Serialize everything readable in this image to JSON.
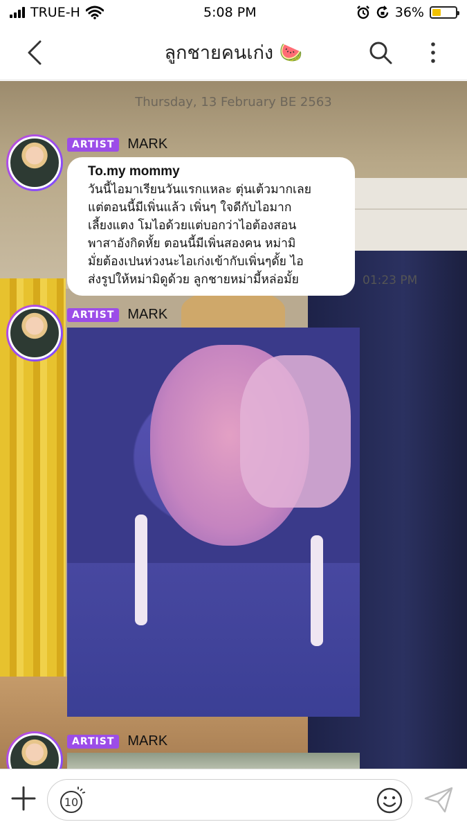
{
  "status_bar": {
    "carrier": "TRUE-H",
    "time": "5:08 PM",
    "battery": "36%",
    "battery_level": 0.36
  },
  "header": {
    "title": "ลูกชายคนเก่ง",
    "title_emoji": "🍉",
    "back_icon": "chevron-left-icon",
    "search_icon": "search-icon",
    "more_icon": "more-vertical-icon"
  },
  "chat": {
    "date_separator": "Thursday, 13 February BE 2563",
    "messages": [
      {
        "badge": "ARTIST",
        "sender": "MARK",
        "type": "text",
        "title": "To.my mommy",
        "text": "วันนี้ไอมาเรียนวันแรกแหละ ตุ่นเต้วมากเลย\nแต่ตอนนี้มีเพิ่นแล้ว เพิ่นๆ ใจดีกับไอมาก\nเลี้ยงแตง โมไอด้วยแต่บอกว่าไอต้องสอน\nพาสาอังกิดหั้ย ตอนนี้มีเพิ่นสองคน หม่ามิ\nมั่ยต้องเปนห่วงนะไอเก่งเข้ากับเพิ่นๆดั้ย ไอ\nส่งรูปให้หม่ามิดูด้วย ลูกชายหม่ามี้หล่อมั้ย",
        "time": "01:23 PM"
      },
      {
        "badge": "ARTIST",
        "sender": "MARK",
        "type": "photo"
      },
      {
        "badge": "ARTIST",
        "sender": "MARK",
        "type": "photo"
      }
    ]
  },
  "composer": {
    "plus_icon": "plus-icon",
    "timer_label": "10",
    "input_placeholder": "",
    "emoji_icon": "smiley-icon",
    "send_icon": "send-icon"
  },
  "colors": {
    "artist_badge": "#9c4de8",
    "battery": "#f2c200",
    "avatar_ring": "#b04fe0"
  }
}
